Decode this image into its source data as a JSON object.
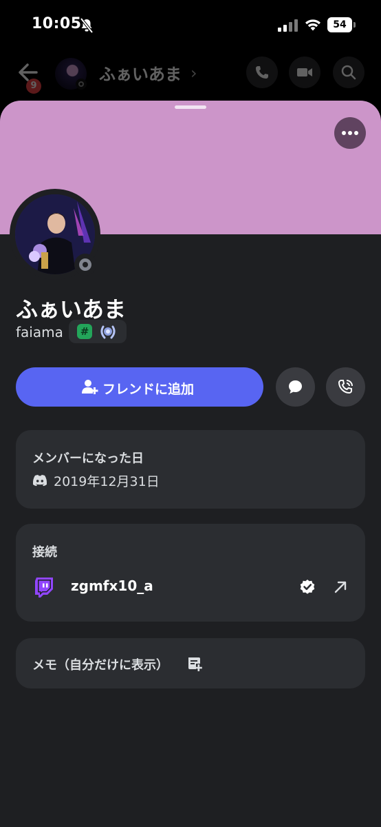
{
  "status_bar": {
    "time": "10:05",
    "battery": "54"
  },
  "chat_header": {
    "unread_count": "9",
    "name": "ふぁいあま",
    "chevron": "›"
  },
  "profile": {
    "display_name": "ふぁいあま",
    "username": "faiama",
    "banner_color": "#cc95c9",
    "badges": {
      "hash_glyph": "#"
    },
    "status": "offline"
  },
  "actions": {
    "add_friend_label": "フレンドに追加"
  },
  "member_since": {
    "title": "メンバーになった日",
    "date": "2019年12月31日"
  },
  "connections": {
    "title": "接続",
    "items": [
      {
        "service": "twitch",
        "name": "zgmfx10_a",
        "verified": true
      }
    ]
  },
  "memo": {
    "label": "メモ（自分だけに表示）"
  },
  "colors": {
    "accent": "#5865f2",
    "background": "#1e1f22",
    "card": "#2b2d31",
    "twitch": "#9146ff"
  }
}
